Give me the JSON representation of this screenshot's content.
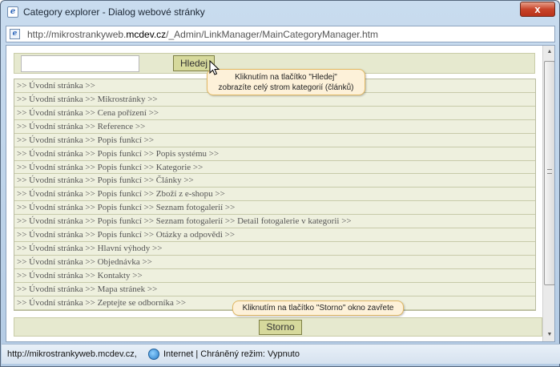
{
  "window": {
    "title": "Category explorer - Dialog webové stránky",
    "close_label": "x"
  },
  "address": {
    "url_prefix": "http://mikrostrankyweb.",
    "url_domain": "mcdev.cz",
    "url_suffix": "/_Admin/LinkManager/MainCategoryManager.htm"
  },
  "search": {
    "value": "",
    "button_label": "Hledej"
  },
  "categories": [
    ">> Úvodní stránka >>",
    ">> Úvodní stránka >> Mikrostránky >>",
    ">> Úvodní stránka >> Cena pořízení >>",
    ">> Úvodní stránka >> Reference >>",
    ">> Úvodní stránka >> Popis funkcí >>",
    ">> Úvodní stránka >> Popis funkcí >> Popis systému >>",
    ">> Úvodní stránka >> Popis funkcí >> Kategorie >>",
    ">> Úvodní stránka >> Popis funkcí >> Články >>",
    ">> Úvodní stránka >> Popis funkcí >> Zboží z e-shopu >>",
    ">> Úvodní stránka >> Popis funkcí >> Seznam fotogalerií >>",
    ">> Úvodní stránka >> Popis funkcí >> Seznam fotogalerií >> Detail fotogalerie v kategorii >>",
    ">> Úvodní stránka >> Popis funkcí >> Otázky a odpovědi >>",
    ">> Úvodní stránka >> Hlavní výhody >>",
    ">> Úvodní stránka >> Objednávka >>",
    ">> Úvodní stránka >> Kontakty >>",
    ">> Úvodní stránka >> Mapa stránek >>",
    ">> Úvodní stránka >> Zeptejte se odborníka >>"
  ],
  "footer": {
    "storno_label": "Storno"
  },
  "tooltips": {
    "search_line1": "Kliknutím na tlačítko \"Hledej\"",
    "search_line2": "zobrazíte celý strom kategorií (článků)",
    "storno": "Kliknutím na tlačítko \"Storno\" okno zavřete"
  },
  "status": {
    "url": "http://mikrostrankyweb.mcdev.cz,",
    "zone": "Internet | Chráněný režim: Vypnuto"
  },
  "icons": {
    "app": "ie-icon",
    "page": "page-icon",
    "zone": "globe-icon"
  }
}
